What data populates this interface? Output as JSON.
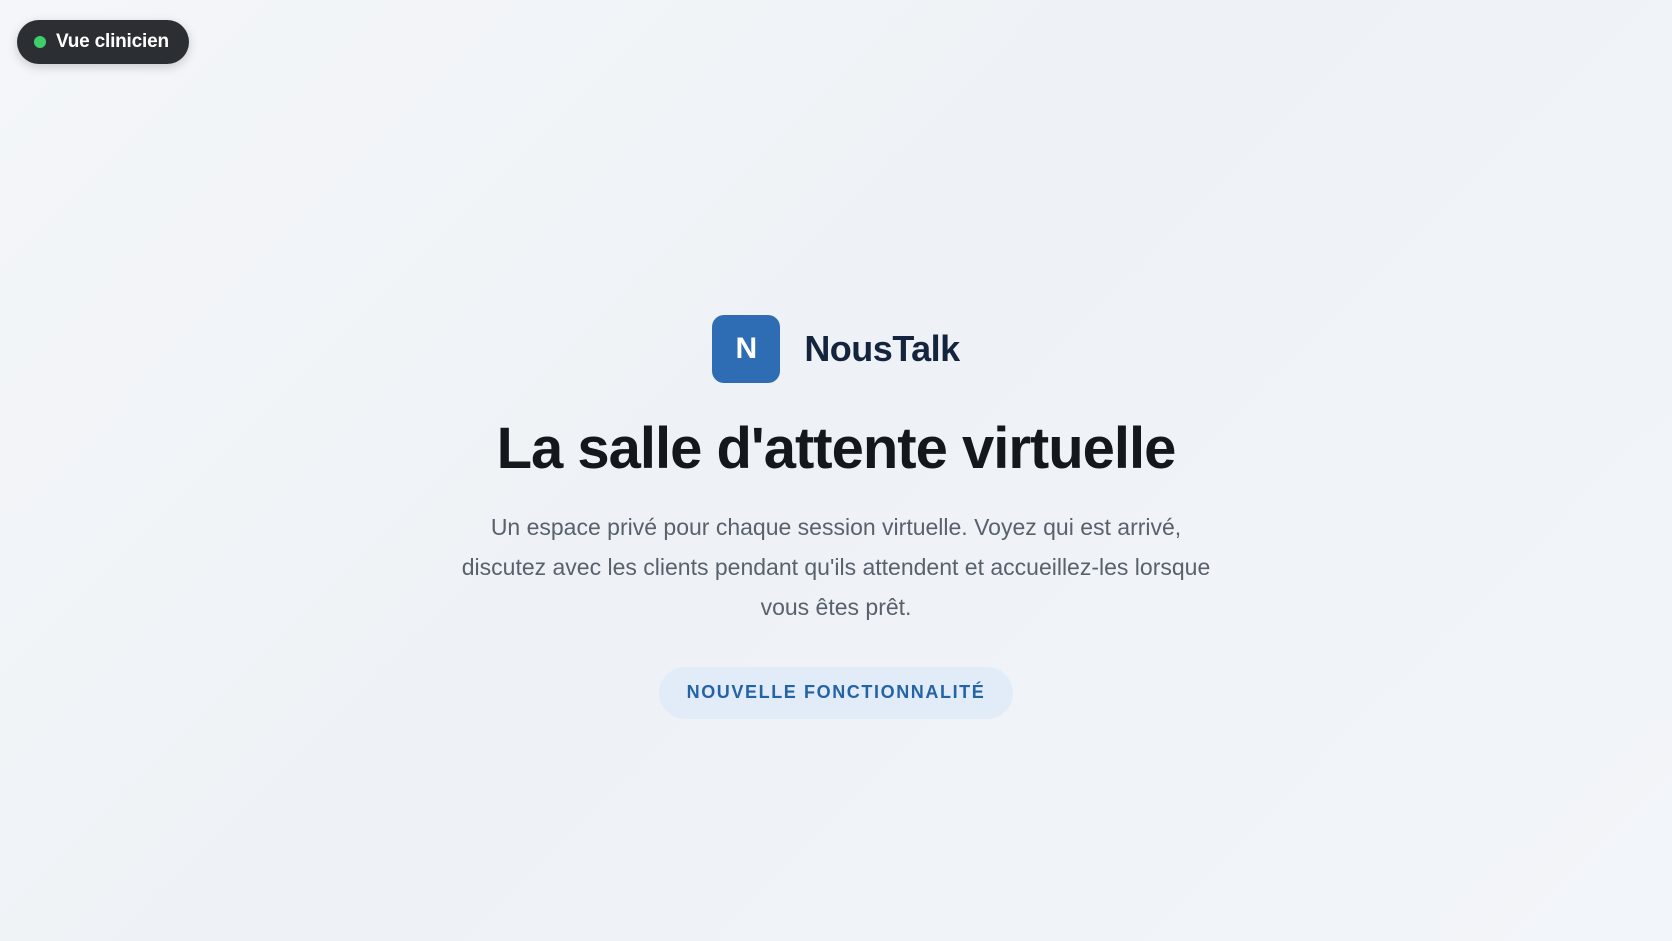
{
  "view_toggle": {
    "label": "Vue clinicien",
    "status_color": "#3fcf6a"
  },
  "brand": {
    "logo_letter": "N",
    "name": "NousTalk",
    "logo_color": "#2e6db3"
  },
  "hero": {
    "title": "La salle d'attente virtuelle",
    "subtitle": "Un  espace privé pour chaque session virtuelle. Voyez qui est arrivé, discutez avec les clients pendant qu'ils attendent et accueillez-les lorsque vous êtes prêt.",
    "badge": "NOUVELLE FONCTIONNALITÉ"
  }
}
